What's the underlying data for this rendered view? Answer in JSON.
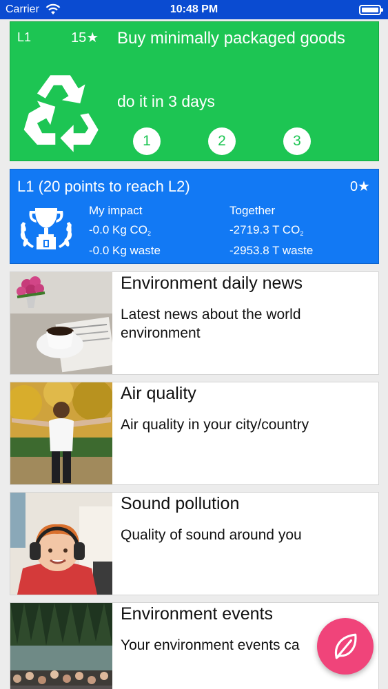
{
  "status_bar": {
    "carrier": "Carrier",
    "time": "10:48 PM"
  },
  "challenge": {
    "level": "L1",
    "stars": "15★",
    "title": "Buy minimally packaged goods",
    "subtitle": "do it in 3 days",
    "days": [
      "1",
      "2",
      "3"
    ],
    "icon": "recycle-icon"
  },
  "impact": {
    "level_text": "L1 (20 points to reach L2)",
    "score": "0★",
    "icon": "trophy-icon",
    "mine": {
      "heading": "My impact",
      "co2_value": "-0.0 Kg CO",
      "co2_sub": "2",
      "waste": "-0.0 Kg waste"
    },
    "together": {
      "heading": "Together",
      "co2_value": "-2719.3 T CO",
      "co2_sub": "2",
      "waste": "-2953.8 T waste"
    }
  },
  "cards": [
    {
      "title": "Environment daily news",
      "description": "Latest news about the world environment"
    },
    {
      "title": "Air quality",
      "description": "Air quality in your city/country"
    },
    {
      "title": "Sound pollution",
      "description": "Quality of sound around you"
    },
    {
      "title": "Environment events",
      "description": "Your environment events ca"
    }
  ],
  "fab": {
    "icon": "leaf-icon"
  },
  "colors": {
    "status_bar": "#0a4bd1",
    "challenge": "#1dc553",
    "impact": "#1279f4",
    "fab": "#f0447a"
  }
}
